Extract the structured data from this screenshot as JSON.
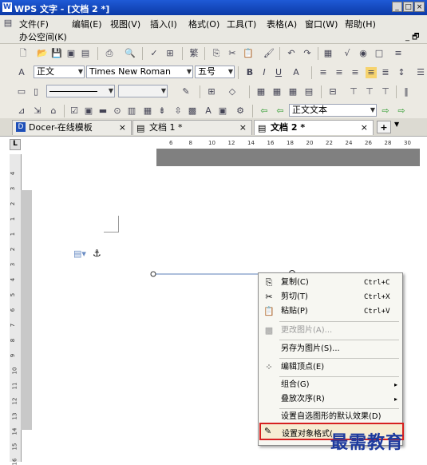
{
  "window": {
    "title": "WPS 文字 - [文档 2 *]",
    "minimize": "_",
    "restore": "□",
    "close": "×"
  },
  "menubar": {
    "items": [
      "文件(F)",
      "编辑(E)",
      "视图(V)",
      "插入(I)",
      "格式(O)",
      "工具(T)",
      "表格(A)",
      "窗口(W)",
      "帮助(H)"
    ],
    "row2": "办公空间(K)",
    "mdi": "_ 🗗"
  },
  "format_toolbar": {
    "style": "正文",
    "font": "Times New Roman",
    "size": "五号"
  },
  "drawing_toolbar": {
    "text_style": "正文文本"
  },
  "tabs": [
    {
      "label": "Docer-在线模板",
      "close": "×"
    },
    {
      "label": "文档 1 *",
      "close": "×"
    },
    {
      "label": "文档 2 *",
      "close": "×"
    }
  ],
  "new_tab": "+",
  "hruler": {
    "ticks": [
      "6",
      "8",
      "10",
      "12",
      "14",
      "16",
      "18",
      "20",
      "22",
      "24",
      "26",
      "28",
      "30"
    ]
  },
  "vruler": {
    "ticks": [
      "4",
      "3",
      "2",
      "1",
      "1",
      "2",
      "3",
      "4",
      "5",
      "6",
      "7",
      "8",
      "9",
      "10",
      "11",
      "12",
      "13",
      "14",
      "15",
      "16"
    ]
  },
  "context_menu": {
    "items": [
      {
        "label": "复制(C)",
        "shortcut": "Ctrl+C",
        "icon": "copy-icon"
      },
      {
        "label": "剪切(T)",
        "shortcut": "Ctrl+X",
        "icon": "scissors-icon"
      },
      {
        "label": "粘贴(P)",
        "shortcut": "Ctrl+V",
        "icon": "paste-icon"
      },
      {
        "label": "更改图片(A)...",
        "disabled": true,
        "icon": "change-picture-icon"
      },
      {
        "label": "另存为图片(S)..."
      },
      {
        "label": "编辑顶点(E)",
        "icon": "edit-points-icon"
      },
      {
        "label": "组合(G)",
        "submenu": true
      },
      {
        "label": "叠放次序(R)",
        "submenu": true
      },
      {
        "label": "设置自选图形的默认效果(D)"
      },
      {
        "label": "设置对象格式(",
        "icon": "format-object-icon",
        "highlighted": true
      }
    ]
  },
  "watermark": "最需教育"
}
